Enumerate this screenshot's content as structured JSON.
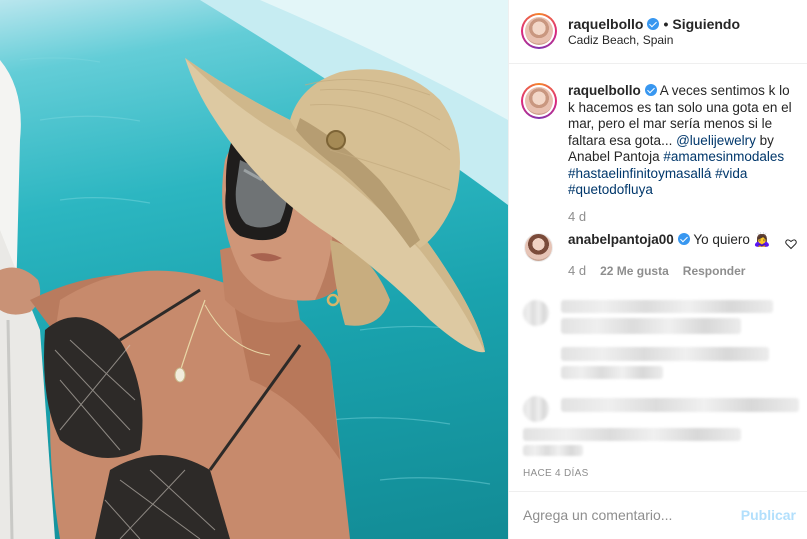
{
  "header": {
    "username": "raquelbollo",
    "separator": "•",
    "follow_status": "Siguiendo",
    "location": "Cadiz Beach, Spain"
  },
  "caption": {
    "username": "raquelbollo",
    "text": "A veces sentimos k lo k hacemos es tan solo una gota en el mar, pero el mar sería menos si le faltara esa gota...",
    "mention": "@luelijewelry",
    "by": "by Anabel Pantoja",
    "hashtags": [
      "#amamesinmodales",
      "#hastaelinfinitoymasallá",
      "#vida",
      "#quetodofluya"
    ],
    "time": "4 d"
  },
  "comment": {
    "username": "anabelpantoja00",
    "text": "Yo quiero 🙇‍♀️",
    "time": "4 d",
    "likes": "22 Me gusta",
    "reply_label": "Responder"
  },
  "post_time": "HACE 4 DÍAS",
  "comment_box": {
    "placeholder": "Agrega un comentario...",
    "publish_label": "Publicar"
  },
  "icons": {
    "verified": "verified-badge-icon",
    "like": "heart-icon"
  },
  "colors": {
    "verified": "#3897f0",
    "link": "#00376b",
    "publish_disabled": "#b2dffc",
    "secondary_text": "#8e8e8e"
  }
}
